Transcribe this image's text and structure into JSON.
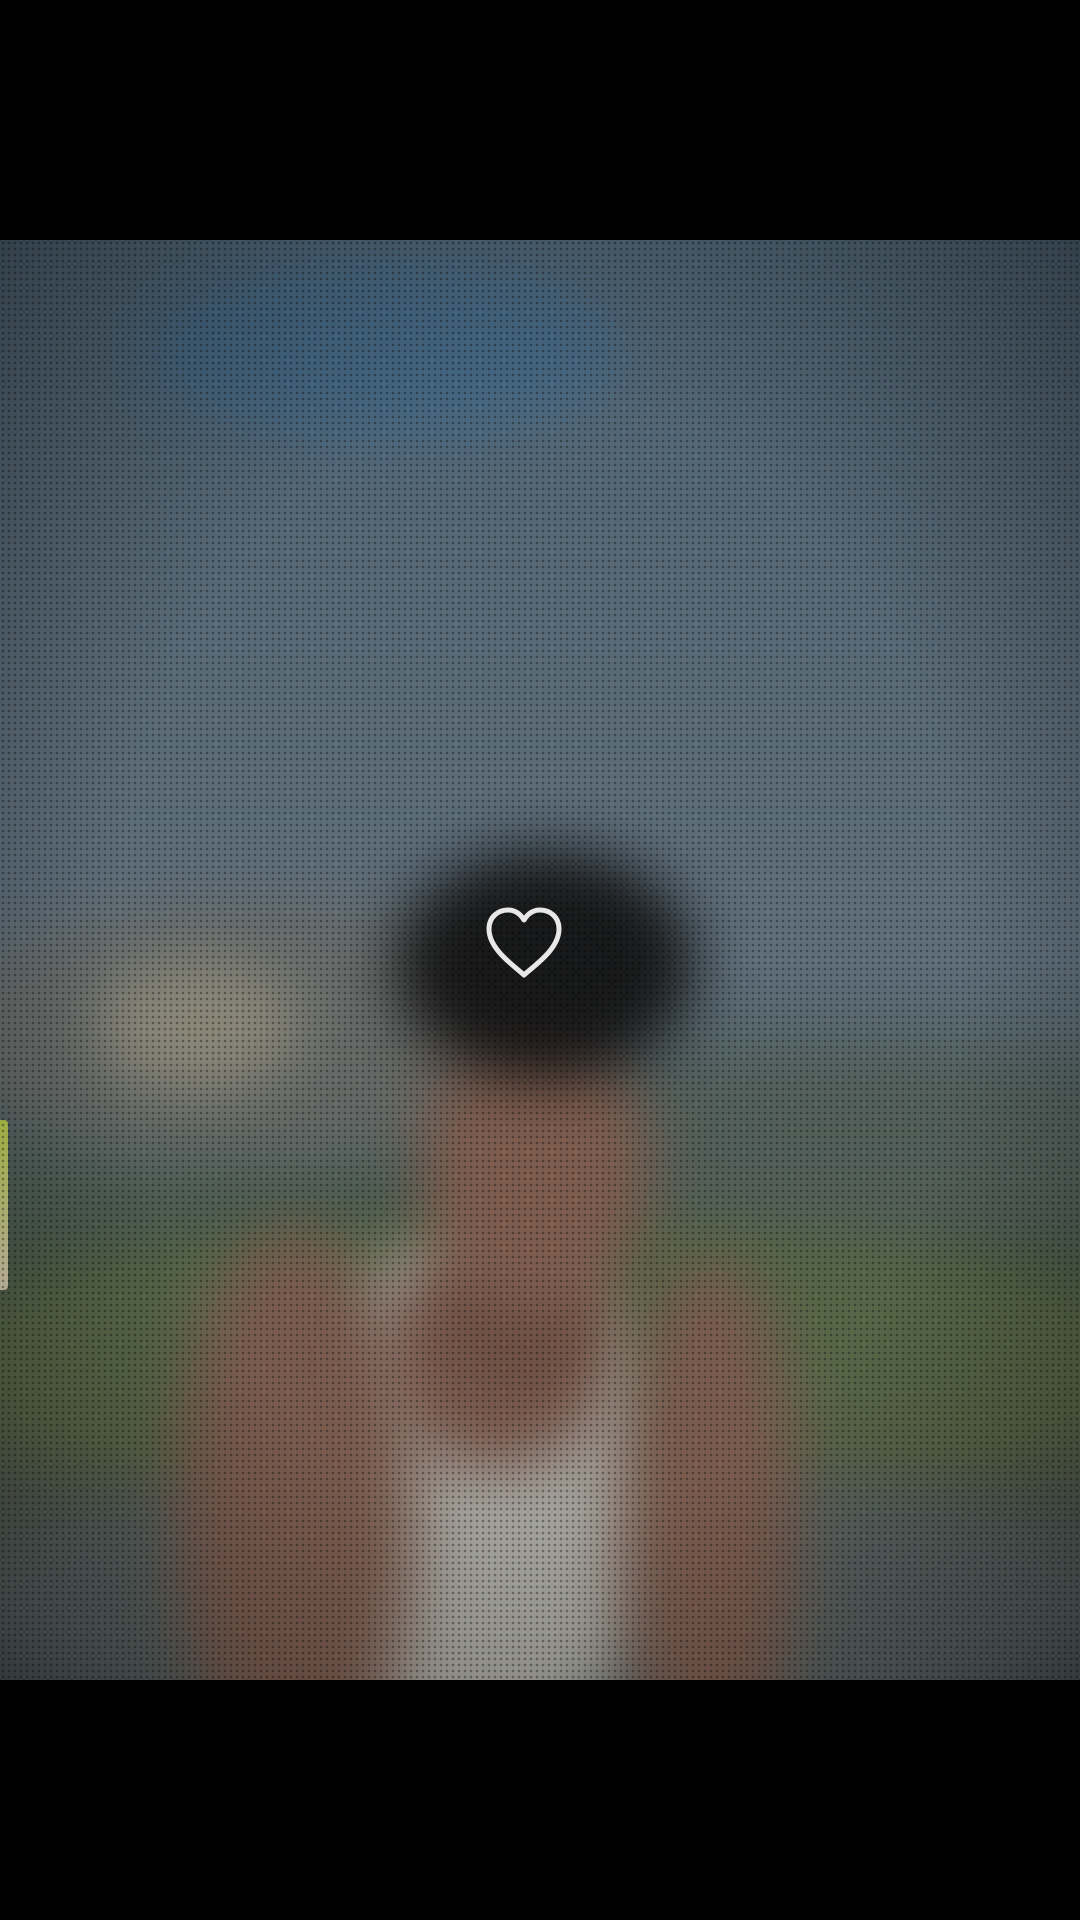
{
  "viewer": {
    "media_type": "video",
    "background_color": "#000000"
  },
  "like": {
    "icon": "heart-outline-icon",
    "state": "not_liked",
    "stroke_color": "#e8e8e8"
  }
}
